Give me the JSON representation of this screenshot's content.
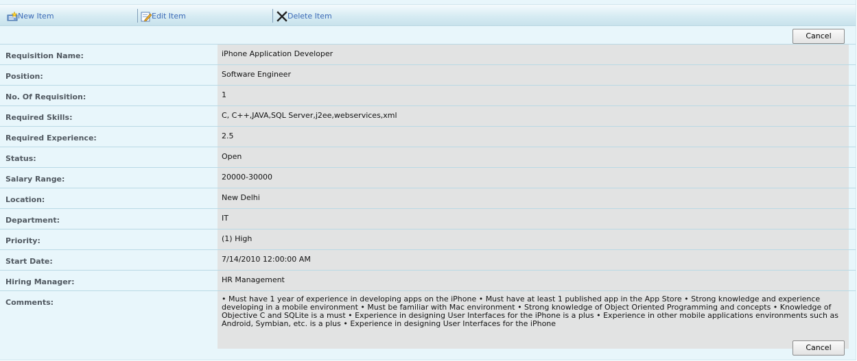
{
  "toolbar": {
    "new_label": "New Item",
    "edit_label": "Edit Item",
    "delete_label": "Delete Item"
  },
  "buttons": {
    "cancel_label": "Cancel"
  },
  "form": {
    "fields": [
      {
        "label": "Requisition Name:",
        "value": "iPhone Application Developer"
      },
      {
        "label": "Position:",
        "value": "Software Engineer"
      },
      {
        "label": "No. Of Requisition:",
        "value": "1"
      },
      {
        "label": "Required Skills:",
        "value": "C, C++,JAVA,SQL Server,j2ee,webservices,xml"
      },
      {
        "label": "Required Experience:",
        "value": "2.5"
      },
      {
        "label": "Status:",
        "value": "Open"
      },
      {
        "label": "Salary Range:",
        "value": "20000-30000"
      },
      {
        "label": "Location:",
        "value": "New Delhi"
      },
      {
        "label": "Department:",
        "value": "IT"
      },
      {
        "label": "Priority:",
        "value": "(1) High"
      },
      {
        "label": "Start Date:",
        "value": "7/14/2010 12:00:00 AM"
      },
      {
        "label": "Hiring Manager:",
        "value": "HR Management"
      }
    ],
    "comments_label": "Comments:",
    "comments_value": "• Must have 1 year of experience in developing apps on the iPhone • Must have at least 1 published app in the App Store • Strong knowledge and experience developing in a mobile environment • Must be familiar with Mac environment • Strong knowledge of Object Oriented Programming and concepts • Knowledge of Objective C and SQLite is a must • Experience in designing User Interfaces for the iPhone is a plus • Experience in other mobile applications environments such as Android, Symbian, etc. is a plus • Experience in designing User Interfaces for the iPhone"
  },
  "icons": {
    "new": "new-item-icon",
    "edit": "edit-item-icon",
    "delete": "delete-x-icon"
  },
  "colors": {
    "panel_bg": "#e8f6fb",
    "value_bg": "#e2e3e3",
    "link": "#3a69b6",
    "label": "#505860"
  }
}
